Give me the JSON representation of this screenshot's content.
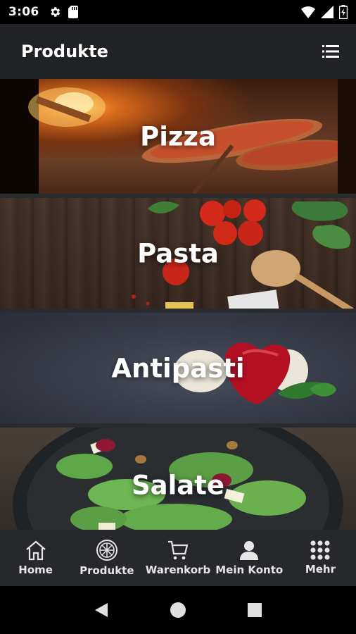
{
  "status": {
    "time": "3:06"
  },
  "app_bar": {
    "title": "Produkte"
  },
  "categories": [
    {
      "label": "Pizza"
    },
    {
      "label": "Pasta"
    },
    {
      "label": "Antipasti"
    },
    {
      "label": "Salate"
    }
  ],
  "bottom_nav": [
    {
      "label": "Home",
      "icon": "home-icon"
    },
    {
      "label": "Produkte",
      "icon": "pizza-icon"
    },
    {
      "label": "Warenkorb",
      "icon": "cart-icon"
    },
    {
      "label": "Mein Konto",
      "icon": "person-icon"
    },
    {
      "label": "Mehr",
      "icon": "grid-icon"
    }
  ]
}
